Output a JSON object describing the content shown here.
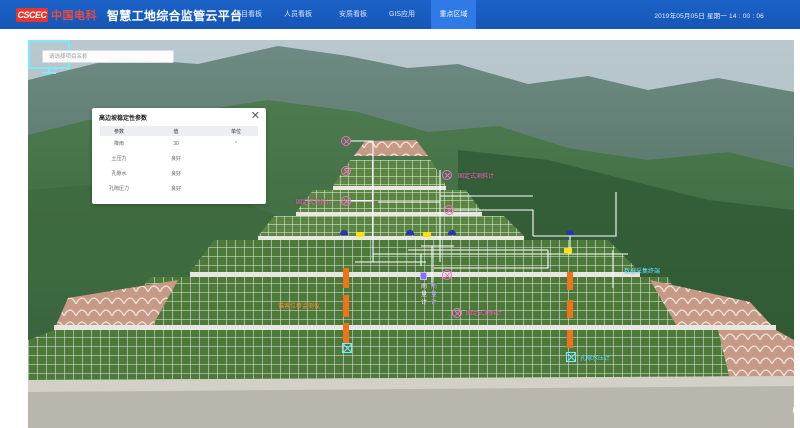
{
  "header": {
    "logo_mark": "CSCEC",
    "logo_text": "中国电科",
    "title": "智慧工地综合监管云平台",
    "nav": [
      {
        "label": "项目看板",
        "active": false
      },
      {
        "label": "人员看板",
        "active": false
      },
      {
        "label": "安质看板",
        "active": false
      },
      {
        "label": "GIS应用",
        "active": false
      },
      {
        "label": "重点区域",
        "active": true
      }
    ],
    "datetime": "2019年05月05日 星期一   14 : 00 : 06"
  },
  "search": {
    "placeholder": "请选择项目名称",
    "value": ""
  },
  "panel": {
    "title": "高边坡稳定性参数",
    "close_icon": "close-icon",
    "columns": [
      "参数",
      "值",
      "单位"
    ],
    "rows": [
      [
        "降雨",
        "30",
        "°"
      ],
      [
        "土压力",
        "良好",
        ""
      ],
      [
        "孔隙水",
        "良好",
        ""
      ],
      [
        "孔隙压力",
        "良好",
        ""
      ]
    ]
  },
  "sensors": {
    "inclinometer_1": "固定式测斜计",
    "inclinometer_2": "固定式测斜计",
    "inclinometer_3": "固定式测斜计",
    "displacement_meter": "锚索位移监测仪",
    "rain_gauge": "雨量计",
    "water_pressure": "孔隙水压计",
    "collector": "数据采集终端"
  },
  "icons": {
    "collector": "monitor-icon",
    "location": "location-pin-icon"
  },
  "colors": {
    "header": "#1656b6",
    "active_tab": "#2f7ae6",
    "sensor_pink": "#f16fc9",
    "sensor_orange": "#f0731c",
    "sensor_cyan": "#7ee8ff"
  }
}
